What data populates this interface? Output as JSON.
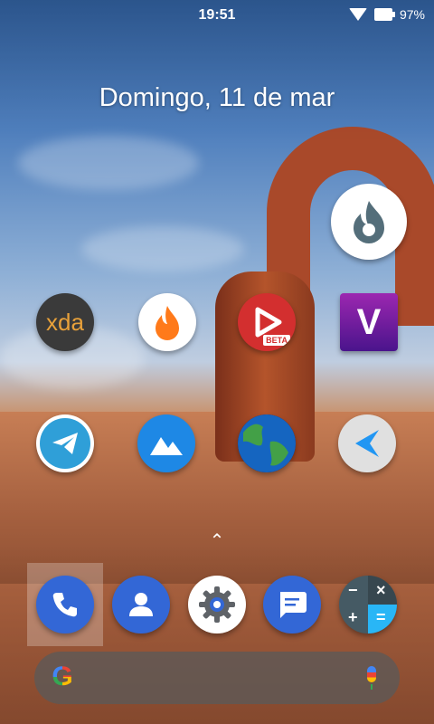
{
  "status_bar": {
    "time": "19:51",
    "battery_percent": "97%"
  },
  "date_widget": {
    "text": "Domingo, 11 de mar"
  },
  "apps": {
    "xda": {
      "label": "xda"
    },
    "viper": {
      "label": "V"
    },
    "beta_badge": {
      "label": "BETA"
    },
    "calc_minus": "−",
    "calc_times": "×",
    "calc_plus": "+",
    "calc_equals": "="
  },
  "search": {
    "google_letter": "G"
  },
  "colors": {
    "accent_blue": "#3367d6",
    "telegram": "#2f9fd8",
    "gallery": "#1e88e5",
    "red_app": "#d32f2f",
    "purple_app": "#7b1fa2"
  }
}
